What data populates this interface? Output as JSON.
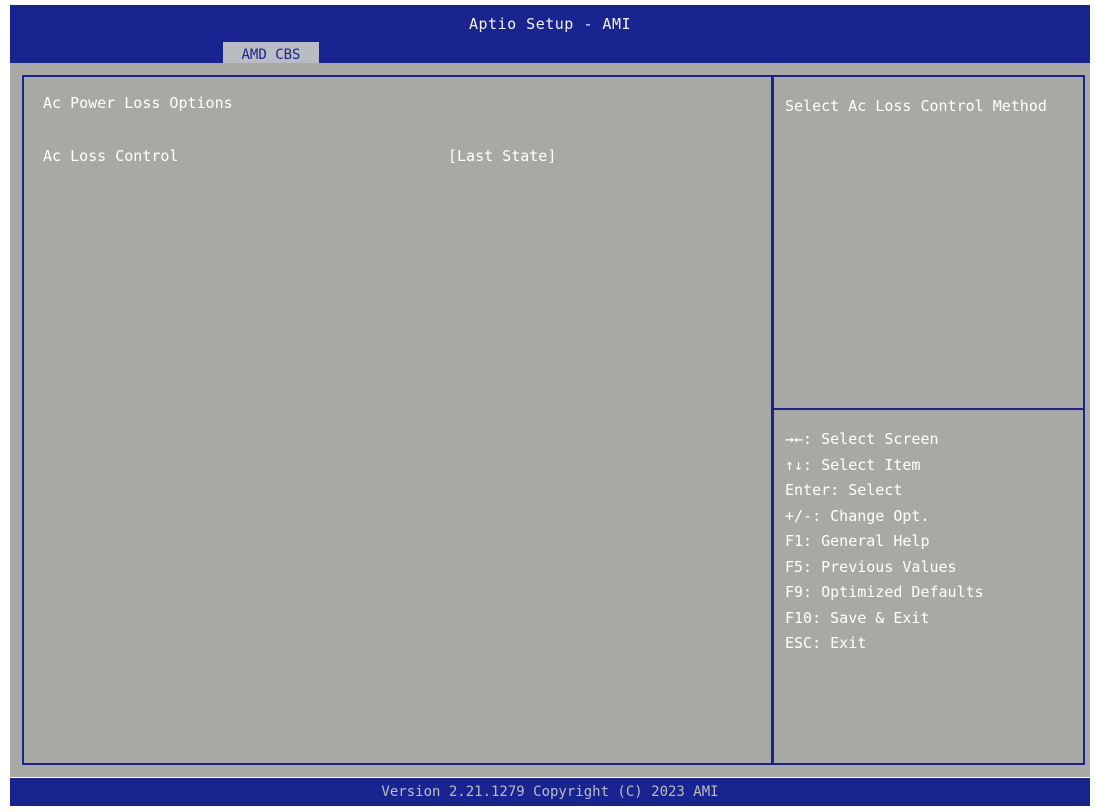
{
  "app": {
    "title": "Aptio Setup - AMI"
  },
  "tabs": [
    {
      "label": "AMD CBS"
    }
  ],
  "main": {
    "section_title": "Ac Power Loss Options",
    "settings": [
      {
        "label": "Ac Loss Control",
        "value": "[Last State]"
      }
    ]
  },
  "help": {
    "text": "Select Ac Loss Control Method"
  },
  "keys": [
    "→←: Select Screen",
    "↑↓: Select Item",
    "Enter: Select",
    "+/-: Change Opt.",
    "F1: General Help",
    "F5: Previous Values",
    "F9: Optimized Defaults",
    "F10: Save & Exit",
    "ESC: Exit"
  ],
  "footer": {
    "text": "Version 2.21.1279 Copyright (C) 2023 AMI"
  },
  "colors": {
    "header_blue": "#1a2491",
    "panel_gray": "#a8a9a5",
    "tab_gray": "#b9bcc3",
    "text_white": "#ffffff"
  }
}
